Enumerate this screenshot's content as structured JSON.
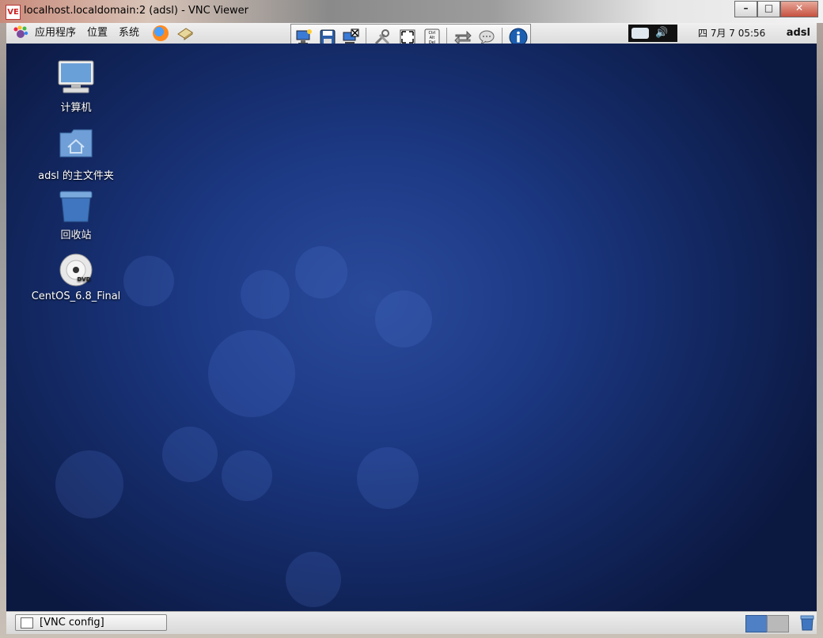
{
  "window": {
    "title": "localhost.localdomain:2 (adsl) - VNC Viewer",
    "icon_text": "VE",
    "buttons": {
      "minimize": "–",
      "maximize": "□",
      "close": "✕"
    }
  },
  "top_panel": {
    "menus": [
      "应用程序",
      "位置",
      "系统"
    ],
    "clock": "四  7月   7 05:56",
    "user": "adsl"
  },
  "vnc_toolbar": {
    "icons": [
      "new-connection-icon",
      "save-icon",
      "disconnect-icon",
      "options-icon",
      "fullscreen-icon",
      "ctrl-alt-del-icon",
      "transfer-icon",
      "chat-icon",
      "info-icon"
    ],
    "ctrl_alt_del_text": "Ctrl Alt Del"
  },
  "desktop": {
    "icons": [
      {
        "name": "computer",
        "label": "计算机"
      },
      {
        "name": "home-folder",
        "label": "adsl 的主文件夹"
      },
      {
        "name": "trash",
        "label": "回收站"
      },
      {
        "name": "dvd",
        "label": "CentOS_6.8_Final",
        "badge": "DVD"
      }
    ]
  },
  "bottom_panel": {
    "task_label": "[VNC config]"
  },
  "colors": {
    "desktop_bg": "#1d3a86",
    "panel_bg": "#e6e6e6",
    "close_button": "#c7513f"
  }
}
